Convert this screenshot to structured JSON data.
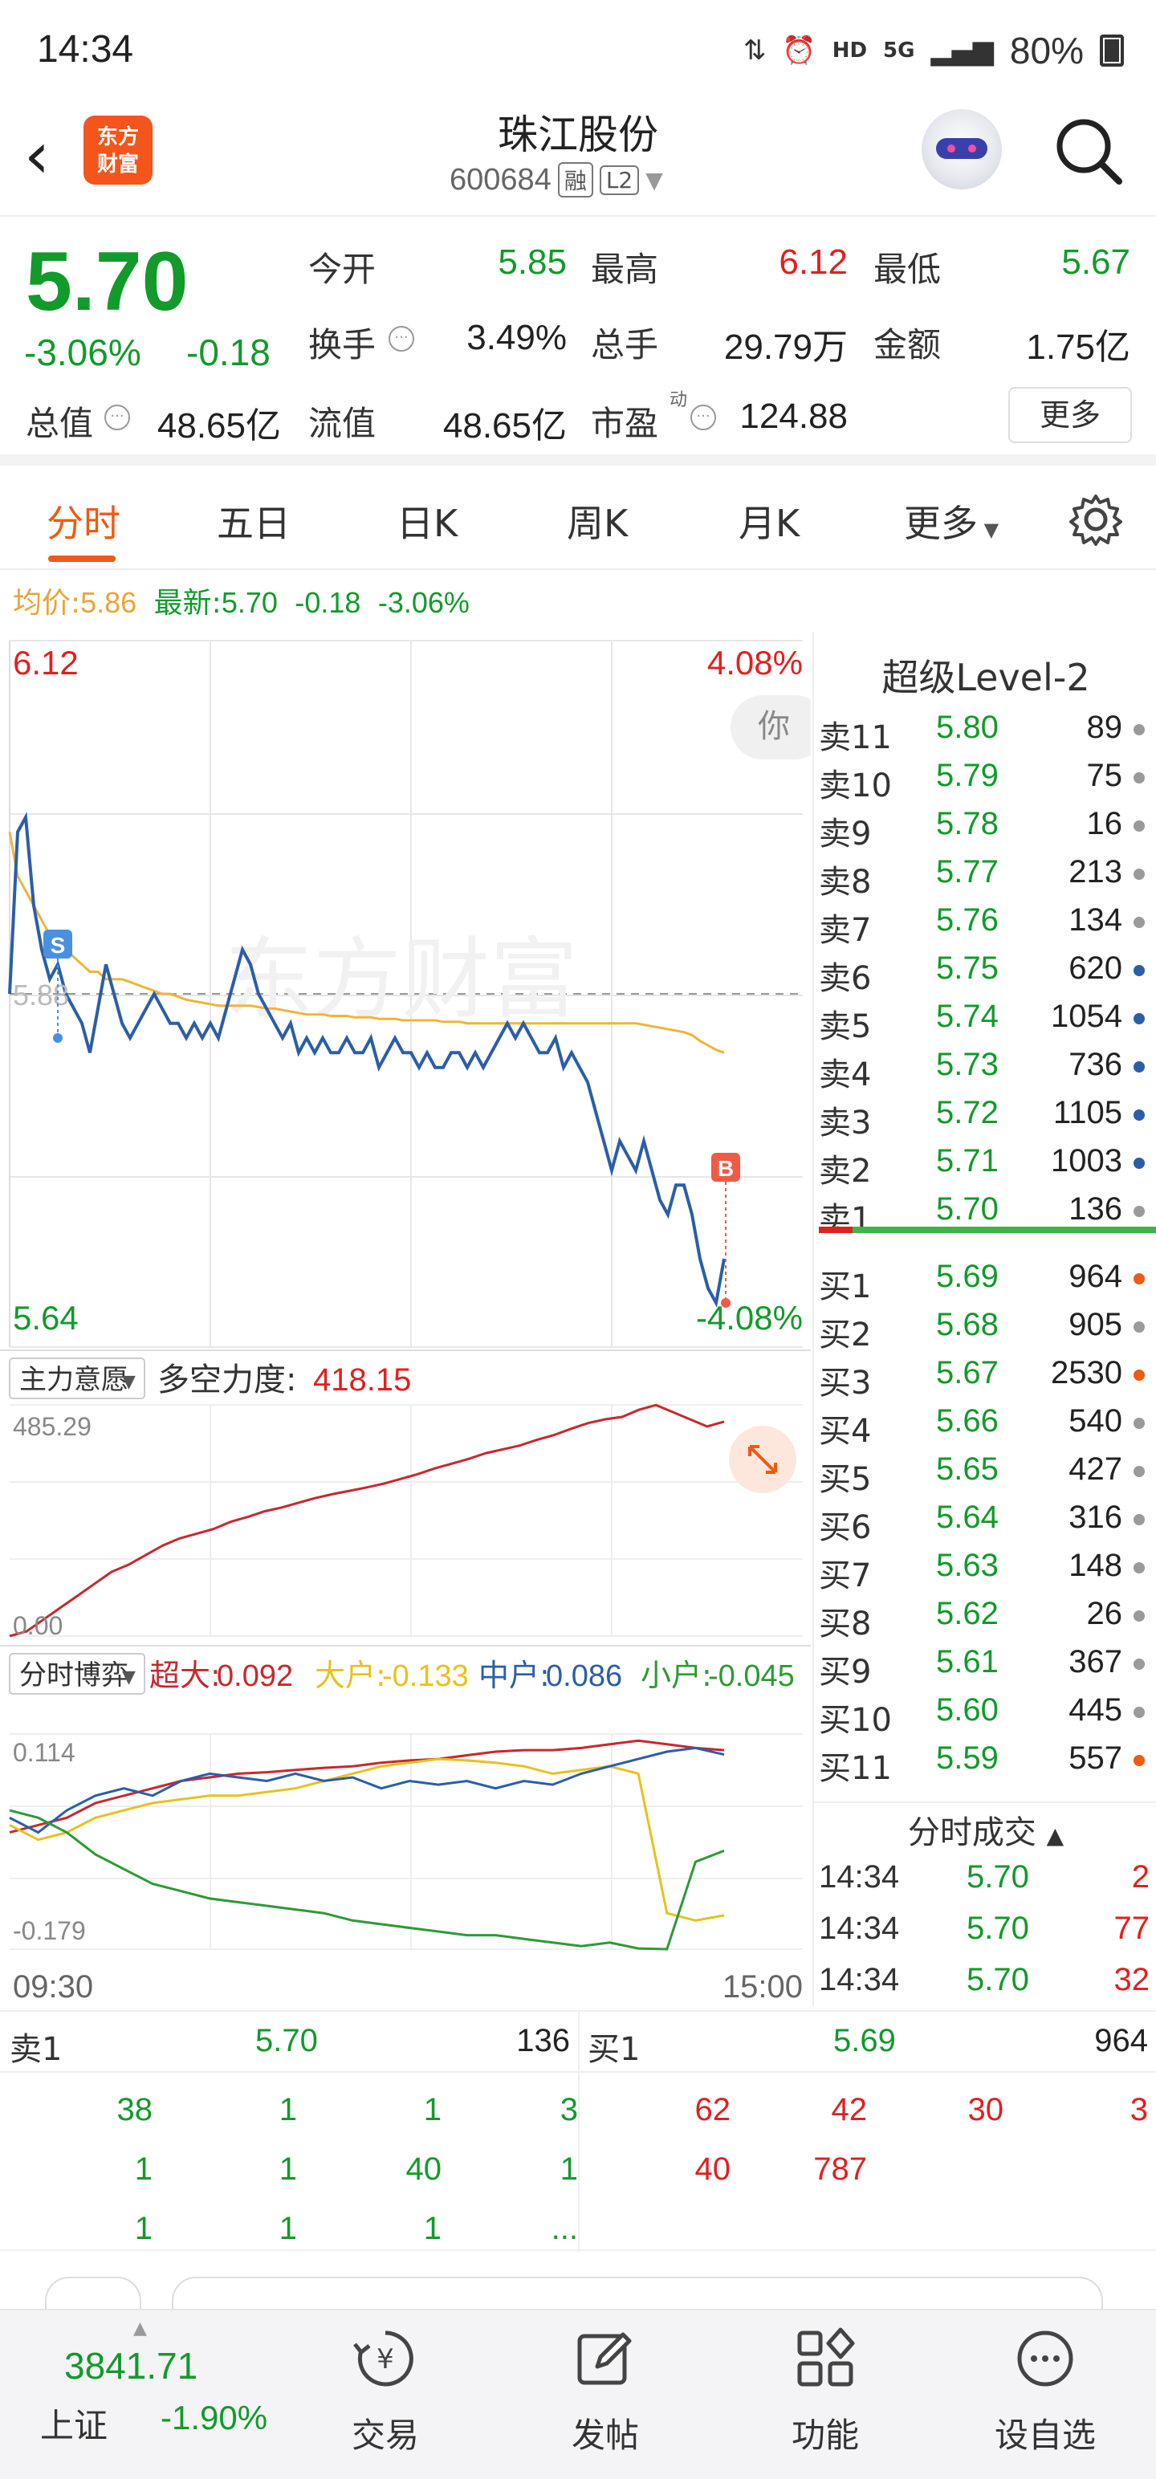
{
  "status_bar": {
    "time": "14:34",
    "network": "HD",
    "signal": "5G",
    "battery": "80%"
  },
  "header": {
    "logo_line1": "东方",
    "logo_line2": "财富",
    "stock_name": "珠江股份",
    "stock_code": "600684",
    "tag1": "融",
    "tag2": "L2"
  },
  "quote": {
    "price": "5.70",
    "change_pct": "-3.06%",
    "change": "-0.18",
    "open_label": "今开",
    "open": "5.85",
    "high_label": "最高",
    "high": "6.12",
    "low_label": "最低",
    "low": "5.67",
    "turnover_label": "换手",
    "turnover": "3.49%",
    "volume_label": "总手",
    "volume": "29.79万",
    "amount_label": "金额",
    "amount": "1.75亿",
    "mktcap_label": "总值",
    "mktcap": "48.65亿",
    "float_label": "流值",
    "float": "48.65亿",
    "pe_label": "市盈",
    "pe_sup": "动",
    "pe": "124.88",
    "more_button": "更多"
  },
  "tabs": [
    "分时",
    "五日",
    "日K",
    "周K",
    "月K",
    "更多"
  ],
  "avg_line": {
    "avg_label": "均价:",
    "avg": "5.86",
    "latest_label": "最新:",
    "latest": "5.70",
    "change": "-0.18",
    "change_pct": "-3.06%"
  },
  "price_chart": {
    "y_top": "6.12",
    "y_bottom": "5.64",
    "pct_top": "4.08%",
    "pct_bottom": "-4.08%",
    "prev_close": "5.88",
    "marker_sell": "S",
    "marker_buy": "B",
    "tooltip": "你",
    "watermark": "东方财富",
    "colors": {
      "price": "#2b5ea8",
      "avg": "#f0b43c",
      "prev_close": "#999999"
    }
  },
  "chart_data": [
    {
      "type": "line",
      "title": "",
      "series": [
        {
          "name": "最新",
          "values": [
            5.88,
            5.99,
            6.0,
            5.94,
            5.91,
            5.89,
            5.9,
            5.88,
            5.87,
            5.86,
            5.84,
            5.87,
            5.9,
            5.88,
            5.86,
            5.85,
            5.86,
            5.87,
            5.88,
            5.87,
            5.86,
            5.86,
            5.85,
            5.86,
            5.85,
            5.86,
            5.85,
            5.87,
            5.89,
            5.91,
            5.9,
            5.88,
            5.87,
            5.86,
            5.85,
            5.86,
            5.84,
            5.85,
            5.84,
            5.85,
            5.84,
            5.84,
            5.85,
            5.84,
            5.84,
            5.85,
            5.83,
            5.84,
            5.85,
            5.84,
            5.84,
            5.83,
            5.84,
            5.83,
            5.83,
            5.84,
            5.84,
            5.83,
            5.84,
            5.83,
            5.84,
            5.85,
            5.86,
            5.85,
            5.86,
            5.85,
            5.84,
            5.84,
            5.85,
            5.83,
            5.84,
            5.83,
            5.82,
            5.8,
            5.78,
            5.76,
            5.78,
            5.77,
            5.76,
            5.78,
            5.76,
            5.74,
            5.73,
            5.75,
            5.75,
            5.73,
            5.7,
            5.68,
            5.67,
            5.7
          ]
        },
        {
          "name": "均价",
          "values": [
            5.99,
            5.96,
            5.95,
            5.94,
            5.93,
            5.92,
            5.915,
            5.91,
            5.905,
            5.9,
            5.895,
            5.895,
            5.89,
            5.89,
            5.89,
            5.888,
            5.886,
            5.884,
            5.882,
            5.88,
            5.88,
            5.878,
            5.876,
            5.875,
            5.874,
            5.873,
            5.872,
            5.872,
            5.872,
            5.872,
            5.872,
            5.871,
            5.87,
            5.87,
            5.869,
            5.868,
            5.867,
            5.866,
            5.866,
            5.866,
            5.865,
            5.865,
            5.865,
            5.864,
            5.864,
            5.864,
            5.863,
            5.863,
            5.863,
            5.862,
            5.862,
            5.862,
            5.862,
            5.862,
            5.861,
            5.861,
            5.861,
            5.86,
            5.86,
            5.86,
            5.86,
            5.86,
            5.86,
            5.86,
            5.86,
            5.86,
            5.86,
            5.86,
            5.86,
            5.86,
            5.86,
            5.86,
            5.86,
            5.86,
            5.86,
            5.86,
            5.86,
            5.86,
            5.86,
            5.859,
            5.858,
            5.857,
            5.856,
            5.855,
            5.854,
            5.852,
            5.848,
            5.845,
            5.842,
            5.84
          ]
        }
      ],
      "ylim": [
        5.64,
        6.12
      ],
      "xlabel": "",
      "ylabel": ""
    },
    {
      "type": "line",
      "title": "",
      "series": [
        {
          "name": "多空力度",
          "values": [
            0,
            10,
            35,
            60,
            85,
            110,
            135,
            150,
            170,
            190,
            205,
            215,
            225,
            240,
            250,
            262,
            270,
            280,
            290,
            298,
            305,
            312,
            320,
            330,
            340,
            352,
            362,
            372,
            384,
            392,
            400,
            412,
            422,
            435,
            447,
            455,
            460,
            475,
            485,
            470,
            455,
            440,
            450
          ]
        }
      ],
      "ylim": [
        0,
        485.29
      ],
      "xlabel": "",
      "ylabel": ""
    },
    {
      "type": "line",
      "title": "",
      "series": [
        {
          "name": "超大",
          "values": [
            -0.02,
            -0.01,
            0.0,
            0.02,
            0.03,
            0.04,
            0.05,
            0.055,
            0.06,
            0.062,
            0.065,
            0.068,
            0.07,
            0.075,
            0.078,
            0.08,
            0.085,
            0.09,
            0.092,
            0.092,
            0.095,
            0.1,
            0.105,
            0.1,
            0.095,
            0.092
          ]
        },
        {
          "name": "大户",
          "values": [
            -0.01,
            -0.03,
            -0.02,
            0.0,
            0.01,
            0.02,
            0.025,
            0.03,
            0.03,
            0.035,
            0.04,
            0.05,
            0.06,
            0.07,
            0.075,
            0.08,
            0.078,
            0.075,
            0.07,
            0.06,
            0.065,
            0.07,
            0.06,
            -0.13,
            -0.14,
            -0.133
          ]
        },
        {
          "name": "中户",
          "values": [
            0.0,
            -0.02,
            0.01,
            0.03,
            0.04,
            0.03,
            0.05,
            0.06,
            0.055,
            0.05,
            0.06,
            0.05,
            0.055,
            0.04,
            0.05,
            0.045,
            0.05,
            0.04,
            0.05,
            0.045,
            0.06,
            0.07,
            0.08,
            0.09,
            0.095,
            0.086
          ]
        },
        {
          "name": "小户",
          "values": [
            0.01,
            0.0,
            -0.02,
            -0.05,
            -0.07,
            -0.09,
            -0.1,
            -0.11,
            -0.115,
            -0.12,
            -0.125,
            -0.13,
            -0.14,
            -0.145,
            -0.15,
            -0.155,
            -0.16,
            -0.16,
            -0.165,
            -0.17,
            -0.175,
            -0.17,
            -0.178,
            -0.179,
            -0.06,
            -0.045
          ]
        }
      ],
      "ylim": [
        -0.179,
        0.114
      ],
      "xlabel": "",
      "ylabel": ""
    }
  ],
  "indicator1": {
    "selector": "主力意愿",
    "label": "多空力度:",
    "value": "418.15",
    "y_top": "485.29",
    "y_bottom": "0.00"
  },
  "indicator2": {
    "selector": "分时博弈",
    "super_label": "超大:",
    "super_value": "0.092",
    "big_label": "大户:",
    "big_value": "-0.133",
    "mid_label": "中户:",
    "mid_value": "0.086",
    "small_label": "小户:",
    "small_value": "-0.045",
    "y_top": "0.114",
    "y_bottom": "-0.179",
    "x_start": "09:30",
    "x_end": "15:00",
    "colors": {
      "super": "#c8282d",
      "big": "#e6c21e",
      "mid": "#2b5ea8",
      "small": "#2e9a35"
    }
  },
  "orderbook": {
    "title": "超级Level-2",
    "asks": [
      {
        "label": "卖11",
        "price": "5.80",
        "volume": "89",
        "dot": "gray"
      },
      {
        "label": "卖10",
        "price": "5.79",
        "volume": "75",
        "dot": "gray"
      },
      {
        "label": "卖9",
        "price": "5.78",
        "volume": "16",
        "dot": "gray"
      },
      {
        "label": "卖8",
        "price": "5.77",
        "volume": "213",
        "dot": "gray"
      },
      {
        "label": "卖7",
        "price": "5.76",
        "volume": "134",
        "dot": "gray"
      },
      {
        "label": "卖6",
        "price": "5.75",
        "volume": "620",
        "dot": "blue"
      },
      {
        "label": "卖5",
        "price": "5.74",
        "volume": "1054",
        "dot": "blue"
      },
      {
        "label": "卖4",
        "price": "5.73",
        "volume": "736",
        "dot": "blue"
      },
      {
        "label": "卖3",
        "price": "5.72",
        "volume": "1105",
        "dot": "blue"
      },
      {
        "label": "卖2",
        "price": "5.71",
        "volume": "1003",
        "dot": "blue"
      },
      {
        "label": "卖1",
        "price": "5.70",
        "volume": "136",
        "dot": "gray"
      }
    ],
    "bids": [
      {
        "label": "买1",
        "price": "5.69",
        "volume": "964",
        "dot": "orange"
      },
      {
        "label": "买2",
        "price": "5.68",
        "volume": "905",
        "dot": "gray"
      },
      {
        "label": "买3",
        "price": "5.67",
        "volume": "2530",
        "dot": "orange"
      },
      {
        "label": "买4",
        "price": "5.66",
        "volume": "540",
        "dot": "gray"
      },
      {
        "label": "买5",
        "price": "5.65",
        "volume": "427",
        "dot": "gray"
      },
      {
        "label": "买6",
        "price": "5.64",
        "volume": "316",
        "dot": "gray"
      },
      {
        "label": "买7",
        "price": "5.63",
        "volume": "148",
        "dot": "gray"
      },
      {
        "label": "买8",
        "price": "5.62",
        "volume": "26",
        "dot": "gray"
      },
      {
        "label": "买9",
        "price": "5.61",
        "volume": "367",
        "dot": "gray"
      },
      {
        "label": "买10",
        "price": "5.60",
        "volume": "445",
        "dot": "gray"
      },
      {
        "label": "买11",
        "price": "5.59",
        "volume": "557",
        "dot": "orange"
      }
    ],
    "trades_title": "分时成交",
    "trades": [
      {
        "time": "14:34",
        "price": "5.70",
        "volume": "2"
      },
      {
        "time": "14:34",
        "price": "5.70",
        "volume": "77"
      },
      {
        "time": "14:34",
        "price": "5.70",
        "volume": "32"
      }
    ]
  },
  "queue": {
    "sell_label": "卖1",
    "sell_price": "5.70",
    "sell_volume": "136",
    "buy_label": "买1",
    "buy_price": "5.69",
    "buy_volume": "964",
    "sell_rows": [
      [
        "38",
        "1",
        "1",
        "3"
      ],
      [
        "1",
        "1",
        "40",
        "1"
      ],
      [
        "1",
        "1",
        "1",
        "..."
      ]
    ],
    "buy_rows": [
      [
        "62",
        "42",
        "30",
        "3"
      ],
      [
        "40",
        "787",
        "",
        ""
      ]
    ]
  },
  "bottom_nav": {
    "index_value": "3841.71",
    "index_name": "上证",
    "index_change": "-1.90%",
    "items": [
      "交易",
      "发帖",
      "功能",
      "设自选"
    ]
  }
}
